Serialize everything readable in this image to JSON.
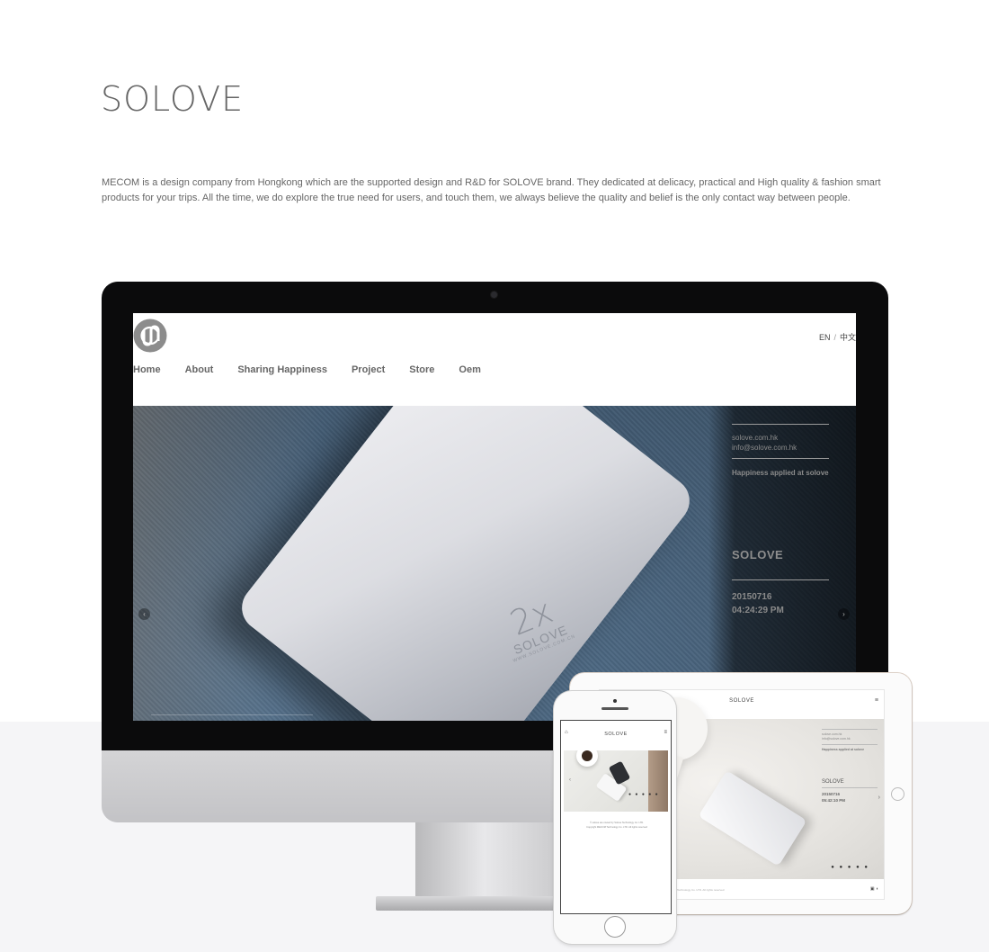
{
  "page": {
    "title": "SOLOVE",
    "intro": "MECOM is a design company from Hongkong which are the supported design and R&D for SOLOVE brand. They dedicated at delicacy, practical and High quality & fashion smart products for your trips. All the time, we do explore the true need for users, and touch them, we always believe the quality and belief is the only contact way between people."
  },
  "desktop_site": {
    "lang": {
      "en": "EN",
      "sep": "/",
      "zh": "中文"
    },
    "nav": [
      "Home",
      "About",
      "Sharing Happiness",
      "Project",
      "Store",
      "Oem"
    ],
    "hero": {
      "product_mark": "2x",
      "product_brand": "SOLOVE",
      "product_url": "WWW.SOLOVE.COM.CN",
      "info": {
        "email_line_1": "solove.com.hk",
        "email_line_2": "info@solove.com.hk",
        "tagline": "Happiness applied at solove",
        "title": "SOLOVE",
        "date": "20150716",
        "time": "04:24:29 PM"
      },
      "prev_arrow": "‹",
      "next_arrow": "›"
    }
  },
  "tablet_site": {
    "title": "SOLOVE",
    "menu": "≡",
    "info": {
      "line_1": "solove.com.hk",
      "line_2": "info@solove.com.hk",
      "tagline": "Happiness applied at solove",
      "title": "SOLOVE",
      "date": "20150716",
      "time": "05:42:10 PM"
    },
    "dots": "● ● ● ● ●",
    "next_arrow": "›",
    "copyright": "Copyright MECOM Technology Co. LTD. All rights reserved",
    "footer_icons": "▣ ◖"
  },
  "phone_site": {
    "home_icon": "⌂",
    "title": "SOLOVE",
    "menu": "≡",
    "dots": "● ● ● ● ●",
    "prev_arrow": "‹",
    "text_line_1": "© solove are owned by Solove Technology Co. LTD.",
    "text_line_2": "Copyright MECOM Technology Co. LTD. All rights reserved"
  },
  "colors": {
    "background": "#ffffff",
    "band": "#f5f5f7",
    "text": "#666666",
    "imac_bezel": "#0b0b0c"
  }
}
